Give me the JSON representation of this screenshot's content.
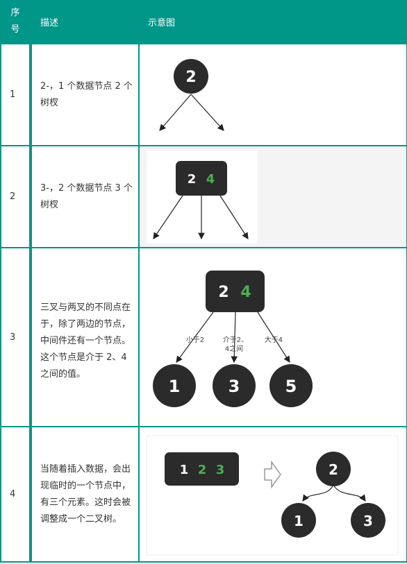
{
  "header": {
    "col_index": "序\n号",
    "col_desc": "描述",
    "col_diagram": "示意图"
  },
  "rows": [
    {
      "index": "1",
      "desc": "2-，1 个数据节点 2 个树杈",
      "diagram": {
        "node": "2"
      }
    },
    {
      "index": "2",
      "desc": "3-，2 个数据节点 3 个树杈",
      "diagram": {
        "key1": "2",
        "key2": "4"
      }
    },
    {
      "index": "3",
      "desc": "三叉与两叉的不同点在于，除了两边的节点，中间件还有一个节点。这个节点是介于 2、4 之间的值。",
      "diagram": {
        "key1": "2",
        "key2": "4",
        "edge_left": "小于2",
        "edge_mid_1": "介于2、",
        "edge_mid_2": "4之间",
        "edge_right": "大于4",
        "child1": "1",
        "child2": "3",
        "child3": "5"
      }
    },
    {
      "index": "4",
      "desc": "当随着插入数据，会出现临时的一个节点中，有三个元素。这时会被调整成一个二叉树。",
      "diagram": {
        "key1": "1",
        "key2": "2",
        "key3": "3",
        "root": "2",
        "left": "1",
        "right": "3"
      }
    }
  ],
  "colors": {
    "header_bg": "#009688",
    "node_fill": "#2b2b2b",
    "green_key": "#4caf50"
  }
}
